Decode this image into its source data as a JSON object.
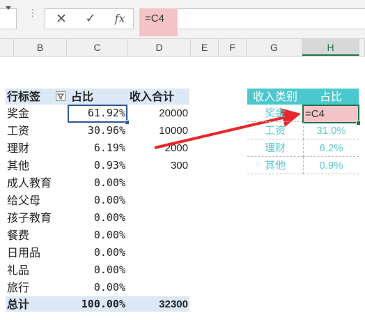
{
  "formula_bar": {
    "formula": "=C4",
    "cancel_glyph": "✕",
    "enter_glyph": "✓",
    "fx_label": "fx"
  },
  "columns": [
    "B",
    "C",
    "D",
    "E",
    "F",
    "G",
    "H"
  ],
  "pivot": {
    "headers": {
      "label": "行标签",
      "pct": "占比",
      "amount": "收入合计"
    },
    "rows": [
      {
        "label": "奖金",
        "pct": "61.92%",
        "amount": "20000"
      },
      {
        "label": "工资",
        "pct": "30.96%",
        "amount": "10000"
      },
      {
        "label": "理财",
        "pct": "6.19%",
        "amount": "2000"
      },
      {
        "label": "其他",
        "pct": "0.93%",
        "amount": "300"
      },
      {
        "label": "成人教育",
        "pct": "0.00%",
        "amount": ""
      },
      {
        "label": "给父母",
        "pct": "0.00%",
        "amount": ""
      },
      {
        "label": "孩子教育",
        "pct": "0.00%",
        "amount": ""
      },
      {
        "label": "餐费",
        "pct": "0.00%",
        "amount": ""
      },
      {
        "label": "日用品",
        "pct": "0.00%",
        "amount": ""
      },
      {
        "label": "礼品",
        "pct": "0.00%",
        "amount": ""
      },
      {
        "label": "旅行",
        "pct": "0.00%",
        "amount": ""
      }
    ],
    "total": {
      "label": "总计",
      "pct": "100.00%",
      "amount": "32300"
    }
  },
  "summary": {
    "headers": {
      "category": "收入类别",
      "pct": "占比"
    },
    "rows": [
      {
        "category": "奖金",
        "value": "=C4"
      },
      {
        "category": "工资",
        "value": "31.0%"
      },
      {
        "category": "理财",
        "value": "6.2%"
      },
      {
        "category": "其他",
        "value": "0.9%"
      }
    ]
  },
  "colors": {
    "accent_header": "#4bc8cd",
    "pivot_band": "#dbe8f6",
    "edit_highlight": "#f4c4c8",
    "arrow": "#e8262b"
  }
}
